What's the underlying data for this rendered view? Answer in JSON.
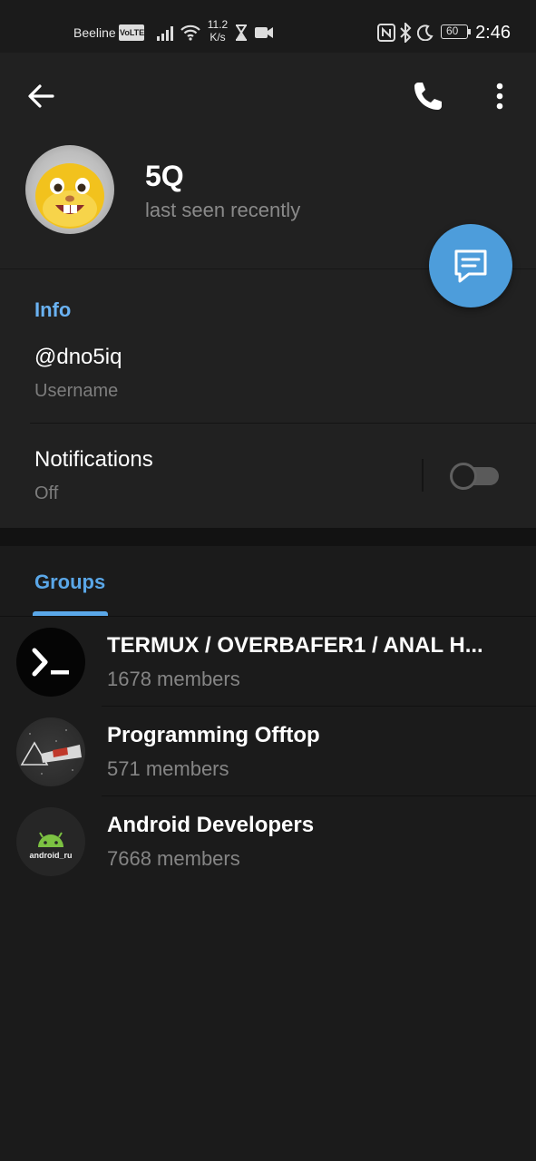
{
  "status_bar": {
    "carrier": "Beeline",
    "volte": "VoLTE",
    "speed_value": "11.2",
    "speed_unit": "K/s",
    "battery": "60",
    "time": "2:46"
  },
  "header": {
    "contact_name": "5Q",
    "last_seen": "last seen recently"
  },
  "info": {
    "section_title": "Info",
    "username_value": "@dno5iq",
    "username_label": "Username",
    "notifications_title": "Notifications",
    "notifications_value": "Off",
    "notifications_enabled": false
  },
  "groups": {
    "tab_label": "Groups",
    "items": [
      {
        "name": "TERMUX / OVERBAFER1 / ANAL H...",
        "members": "1678 members",
        "avatar_icon": "terminal-prompt-icon"
      },
      {
        "name": "Programming Offtop",
        "members": "571 members",
        "avatar_icon": "prism-avatar-icon"
      },
      {
        "name": "Android Developers",
        "members": "7668 members",
        "avatar_icon": "android-robot-icon",
        "avatar_caption": "android_ru"
      }
    ]
  },
  "colors": {
    "accent": "#6ab2f2",
    "fab": "#4d9ddb",
    "background": "#1b1b1b",
    "surface": "#212121"
  }
}
